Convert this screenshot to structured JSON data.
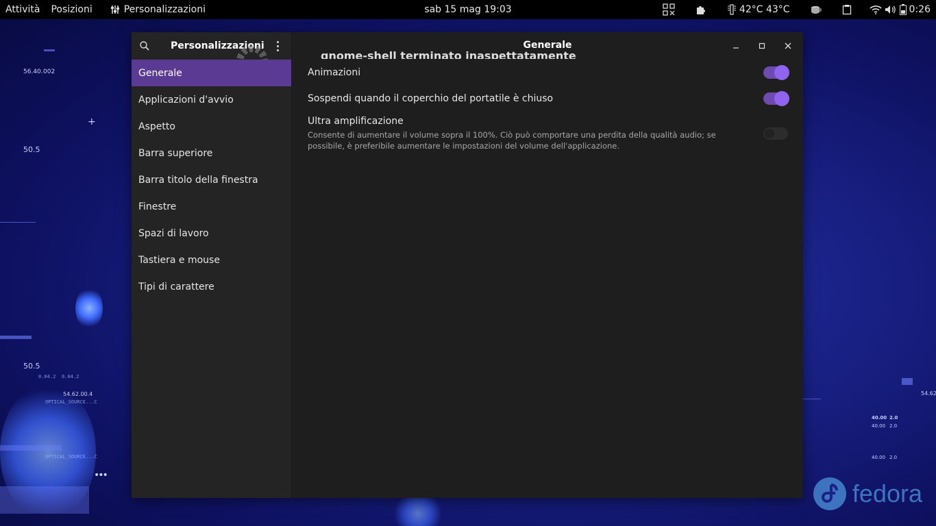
{
  "topbar": {
    "activities": "Attività",
    "places": "Posizioni",
    "app_name": "Personalizzazioni",
    "clock": "sab 15 mag  19:03",
    "temps": "42°C 43°C",
    "time": "0:26"
  },
  "window": {
    "sidebar_title": "Personalizzazioni",
    "content_title": "Generale",
    "overlay_text": "gnome-shell terminato inaspettatamente",
    "sidebar_items": [
      {
        "label": "Generale",
        "active": true
      },
      {
        "label": "Applicazioni d'avvio"
      },
      {
        "label": "Aspetto"
      },
      {
        "label": "Barra superiore"
      },
      {
        "label": "Barra titolo della finestra"
      },
      {
        "label": "Finestre"
      },
      {
        "label": "Spazi di lavoro"
      },
      {
        "label": "Tastiera e mouse"
      },
      {
        "label": "Tipi di carattere"
      }
    ],
    "settings": [
      {
        "label": "Animazioni",
        "enabled": true
      },
      {
        "label": "Sospendi quando il coperchio del portatile è chiuso",
        "enabled": true
      },
      {
        "label": "Ultra amplificazione",
        "description": "Consente di aumentare il volume sopra il 100%. Ciò può comportare una perdita della qualità audio; se possibile, è preferibile aumentare le impostazioni del volume dell'applicazione.",
        "enabled": false
      }
    ]
  },
  "wallpaper": {
    "brand": "fedora",
    "labels": [
      "56.40.",
      "002",
      "50.5",
      "50.5",
      "54.62.00.4",
      "OPTICAL_SOURCE...C",
      "OPTICAL_SOURCE...C",
      "0.04.2",
      "0.04.2",
      "40.00",
      "2.0",
      "40.00",
      "2.0",
      "40.00",
      "2.0",
      "54.62"
    ]
  },
  "colors": {
    "accent": "#5b3a93",
    "toggle_on": "#9164f0",
    "fedora_blue": "#3e73c0"
  }
}
